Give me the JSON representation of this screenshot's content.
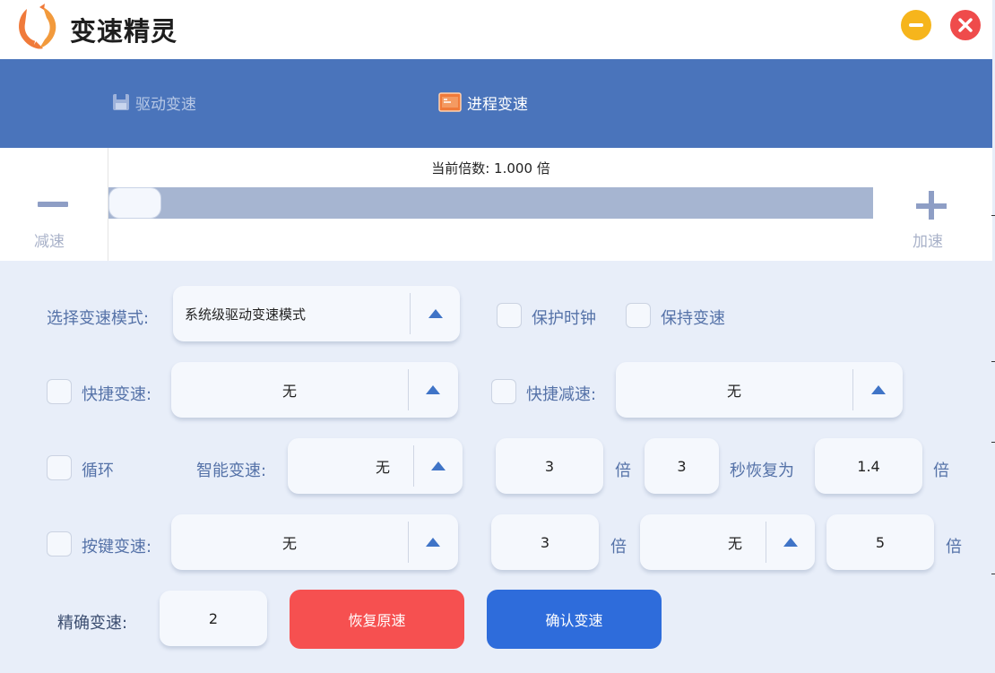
{
  "app": {
    "title": "变速精灵"
  },
  "tabs": [
    {
      "label": "驱动变速",
      "active": false
    },
    {
      "label": "进程变速",
      "active": true
    }
  ],
  "speed": {
    "current_text": "当前倍数: 1.000 倍",
    "decrease_label": "减速",
    "increase_label": "加速",
    "slider_level": 0.0
  },
  "form": {
    "mode": {
      "label": "选择变速模式:",
      "value": "系统级驱动变速模式"
    },
    "protect_clock": {
      "label": "保护时钟",
      "checked": false
    },
    "keep_speed": {
      "label": "保持变速",
      "checked": false
    },
    "hotkey_speed": {
      "label": "快捷变速:",
      "value": "无",
      "checked": false
    },
    "hotkey_slow": {
      "label": "快捷减速:",
      "value": "无",
      "checked": false
    },
    "loop": {
      "label": "循环",
      "checked": false,
      "smart_label": "智能变速:",
      "smart_value": "无",
      "multiplier": "3",
      "multiplier_unit": "倍",
      "seconds": "3",
      "restore_label": "秒恢复为",
      "restore_value": "1.4",
      "restore_unit": "倍"
    },
    "key_speed": {
      "label": "按键变速:",
      "checked": false,
      "value": "无",
      "multiplier": "3",
      "multiplier_unit": "倍",
      "key2_value": "无",
      "multiplier2": "5",
      "multiplier2_unit": "倍"
    },
    "precise": {
      "label": "精确变速:",
      "value": "2"
    }
  },
  "buttons": {
    "restore": "恢复原速",
    "confirm": "确认变速"
  },
  "colors": {
    "tab_bar": "#4a74bb",
    "restore_button": "#f65050",
    "confirm_button": "#2e6cdb",
    "minimize": "#f6b51c",
    "close": "#ef4b4b"
  }
}
